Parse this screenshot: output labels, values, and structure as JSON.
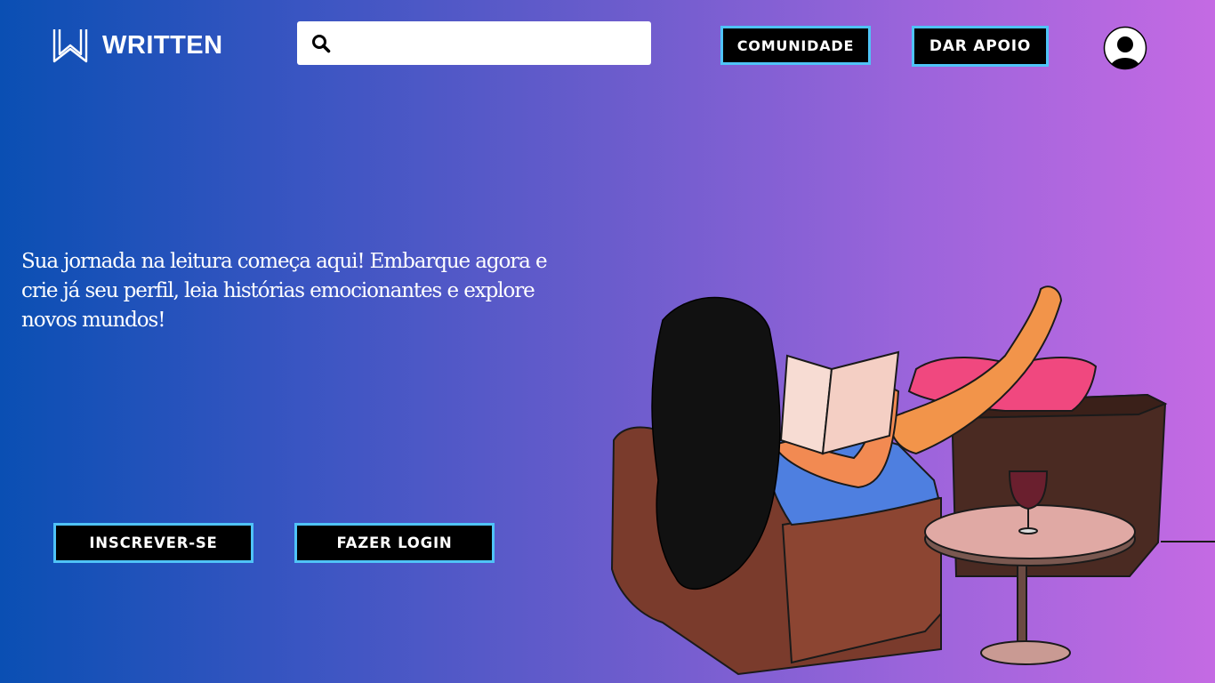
{
  "brand": {
    "name": "WRITTEN",
    "icon": "w-logo-icon"
  },
  "search": {
    "placeholder": "",
    "value": "",
    "icon": "search-icon"
  },
  "nav": {
    "community_label": "COMUNIDADE",
    "support_label": "DAR APOIO",
    "profile_icon": "user-avatar-icon"
  },
  "hero": {
    "text": "Sua jornada na leitura começa aqui! Embarque agora e crie já seu perfil, leia histórias emocionantes e explore novos mundos!",
    "signup_label": "INSCREVER-SE",
    "login_label": "FAZER LOGIN",
    "illustration": "woman-reading-on-armchair-illustration"
  },
  "colors": {
    "gradient_start": "#0a4fb3",
    "gradient_end": "#c46ae3",
    "button_bg": "#000000",
    "button_border": "#4fc3f7",
    "text": "#ffffff"
  }
}
